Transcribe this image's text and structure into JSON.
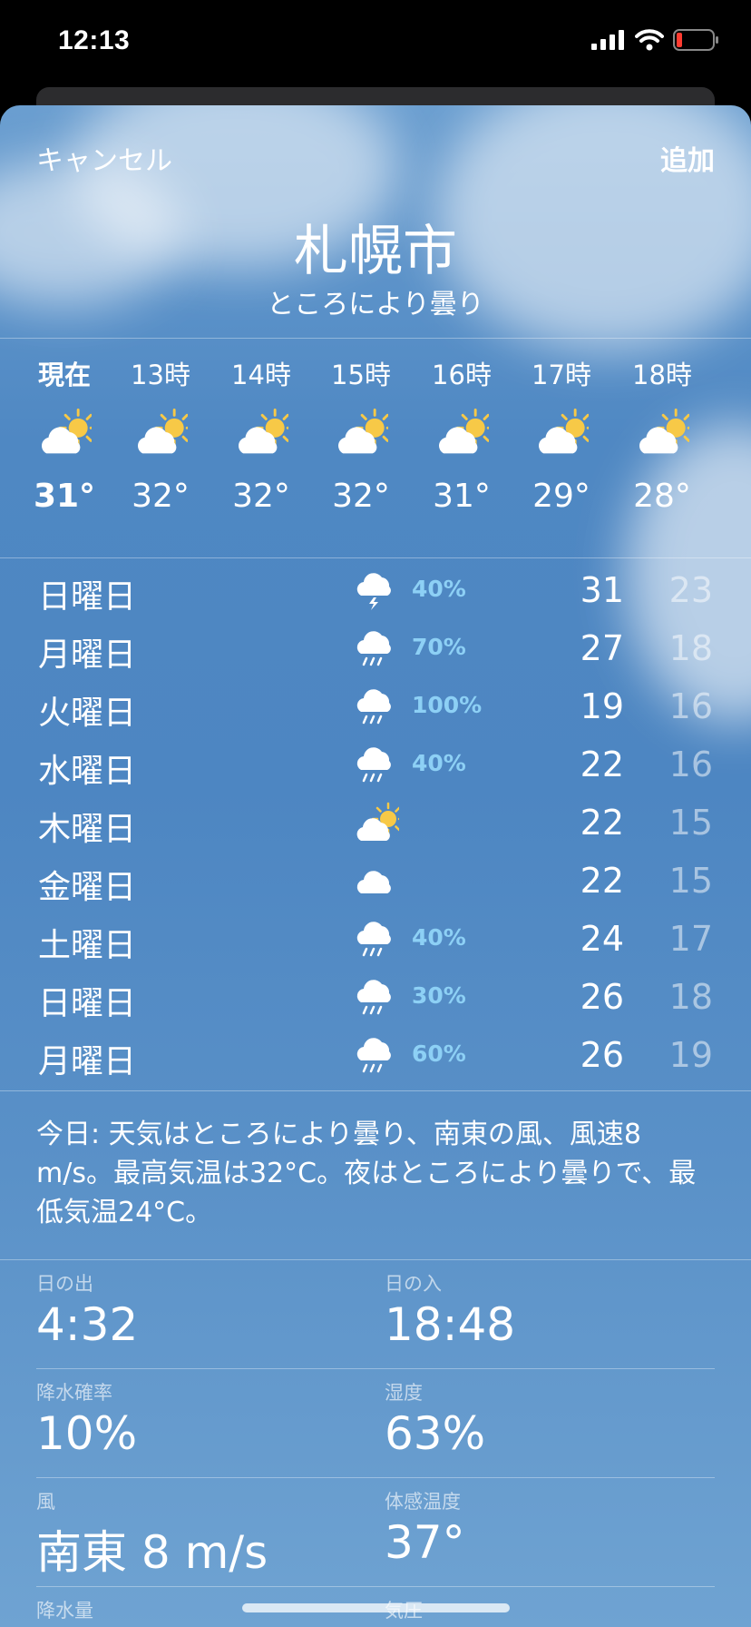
{
  "status": {
    "time": "12:13"
  },
  "nav": {
    "cancel_label": "キャンセル",
    "add_label": "追加"
  },
  "location": {
    "city": "札幌市",
    "condition": "ところにより曇り"
  },
  "hourly": [
    {
      "label": "現在",
      "icon": "partly-sunny-icon",
      "temp": "31°"
    },
    {
      "label": "13時",
      "icon": "partly-sunny-icon",
      "temp": "32°"
    },
    {
      "label": "14時",
      "icon": "partly-sunny-icon",
      "temp": "32°"
    },
    {
      "label": "15時",
      "icon": "partly-sunny-icon",
      "temp": "32°"
    },
    {
      "label": "16時",
      "icon": "partly-sunny-icon",
      "temp": "31°"
    },
    {
      "label": "17時",
      "icon": "partly-sunny-icon",
      "temp": "29°"
    },
    {
      "label": "18時",
      "icon": "partly-sunny-icon",
      "temp": "28°"
    }
  ],
  "daily": [
    {
      "day": "日曜日",
      "icon": "thunderstorm-icon",
      "pct": "40%",
      "high": "31",
      "low": "23"
    },
    {
      "day": "月曜日",
      "icon": "rain-icon",
      "pct": "70%",
      "high": "27",
      "low": "18"
    },
    {
      "day": "火曜日",
      "icon": "rain-icon",
      "pct": "100%",
      "high": "19",
      "low": "16"
    },
    {
      "day": "水曜日",
      "icon": "rain-icon",
      "pct": "40%",
      "high": "22",
      "low": "16"
    },
    {
      "day": "木曜日",
      "icon": "partly-sunny-icon",
      "pct": "",
      "high": "22",
      "low": "15"
    },
    {
      "day": "金曜日",
      "icon": "cloud-icon",
      "pct": "",
      "high": "22",
      "low": "15"
    },
    {
      "day": "土曜日",
      "icon": "rain-icon",
      "pct": "40%",
      "high": "24",
      "low": "17"
    },
    {
      "day": "日曜日",
      "icon": "rain-icon",
      "pct": "30%",
      "high": "26",
      "low": "18"
    },
    {
      "day": "月曜日",
      "icon": "rain-icon",
      "pct": "60%",
      "high": "26",
      "low": "19"
    }
  ],
  "summary": "今日: 天気はところにより曇り、南東の風、風速8 m/s。最高気温は32°C。夜はところにより曇りで、最低気温24°C。",
  "details": [
    [
      {
        "label": "日の出",
        "value": "4:32"
      },
      {
        "label": "日の入",
        "value": "18:48"
      }
    ],
    [
      {
        "label": "降水確率",
        "value": "10%"
      },
      {
        "label": "湿度",
        "value": "63%"
      }
    ],
    [
      {
        "label": "風",
        "value": "南東 8 m/s"
      },
      {
        "label": "体感温度",
        "value": "37°"
      }
    ],
    [
      {
        "label": "降水量",
        "value": ""
      },
      {
        "label": "気圧",
        "value": ""
      }
    ]
  ],
  "colors": {
    "precip": "#8dd0f5",
    "sun": "#f7c947",
    "battery_low": "#ff3b30"
  }
}
